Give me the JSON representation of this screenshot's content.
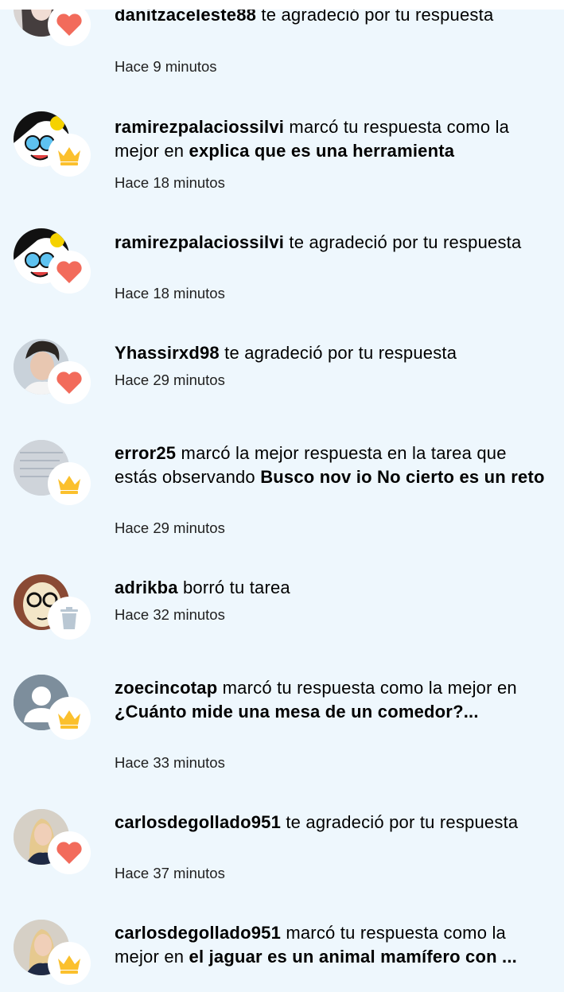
{
  "notifications": [
    {
      "user": "danitzaceleste88",
      "action": " te agradeció por tu respuesta",
      "subject": "",
      "time": "Hace 9 minutos",
      "badge": "heart-icon"
    },
    {
      "user": "ramirezpalaciossilvi",
      "action": " marcó tu respuesta como la mejor en ",
      "subject": "explica que es una herramienta",
      "time": "Hace 18 minutos",
      "badge": "crown-icon"
    },
    {
      "user": "ramirezpalaciossilvi",
      "action": " te agradeció por tu respuesta",
      "subject": "",
      "time": "Hace 18 minutos",
      "badge": "heart-icon"
    },
    {
      "user": "Yhassirxd98",
      "action": " te agradeció por tu respuesta",
      "subject": "",
      "time": "Hace 29 minutos",
      "badge": "heart-icon"
    },
    {
      "user": "error25",
      "action": " marcó la mejor respuesta en la tarea que estás observando ",
      "subject": "Busco nov io No cierto es un reto",
      "time": "Hace 29 minutos",
      "badge": "crown-icon"
    },
    {
      "user": "adrikba",
      "action": " borró tu tarea",
      "subject": "",
      "time": "Hace 32 minutos",
      "badge": "trash-icon"
    },
    {
      "user": "zoecincotap",
      "action": " marcó tu respuesta como la mejor en ",
      "subject": "¿Cuánto mide una mesa de un comedor?...",
      "time": "Hace 33 minutos",
      "badge": "crown-icon"
    },
    {
      "user": "carlosdegollado951",
      "action": " te agradeció por tu respuesta",
      "subject": "",
      "time": "Hace 37 minutos",
      "badge": "heart-icon"
    },
    {
      "user": "carlosdegollado951",
      "action": " marcó tu respuesta como la mejor en ",
      "subject": "el jaguar es un animal mamífero con ...",
      "time": "",
      "badge": "crown-icon"
    }
  ],
  "colors": {
    "background": "#eef7fd",
    "heart": "#f26b5b",
    "crown": "#fbc02d",
    "trash": "#b9c7d3"
  }
}
